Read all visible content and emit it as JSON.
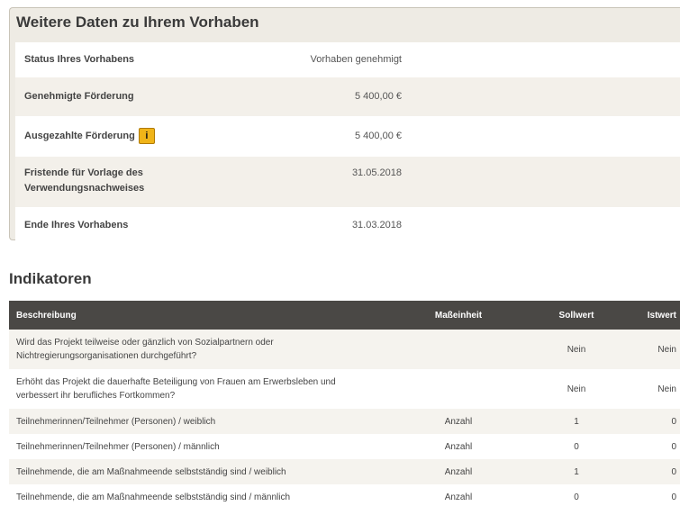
{
  "details": {
    "title": "Weitere Daten zu Ihrem Vorhaben",
    "rows": [
      {
        "label": "Status Ihres Vorhabens",
        "value": "Vorhaben genehmigt"
      },
      {
        "label": "Genehmigte Förderung",
        "value": "5 400,00 €"
      },
      {
        "label": "Ausgezahlte Förderung",
        "value": "5 400,00 €",
        "icon": "info-icon"
      },
      {
        "label": "Fristende für Vorlage des Verwendungsnachweises",
        "label_line1": "Fristende für Vorlage des",
        "label_line2": "Verwendungsnachweises",
        "value": "31.05.2018"
      },
      {
        "label": "Ende Ihres Vorhabens",
        "value": "31.03.2018"
      }
    ]
  },
  "indicators": {
    "title": "Indikatoren",
    "headers": {
      "description": "Beschreibung",
      "unit": "Maßeinheit",
      "target": "Sollwert",
      "actual": "Istwert"
    },
    "rows": [
      {
        "line1": "Wird das Projekt teilweise oder gänzlich von Sozialpartnern oder",
        "line2": "Nichtregierungsorganisationen durchgeführt?",
        "unit": "",
        "target": "Nein",
        "actual": "Nein"
      },
      {
        "line1": "Erhöht das Projekt die dauerhafte Beteiligung von Frauen am Erwerbsleben und",
        "line2": "verbessert ihr berufliches Fortkommen?",
        "unit": "",
        "target": "Nein",
        "actual": "Nein"
      },
      {
        "line1": "Teilnehmerinnen/Teilnehmer (Personen) / weiblich",
        "unit": "Anzahl",
        "target": "1",
        "actual": "0"
      },
      {
        "line1": "Teilnehmerinnen/Teilnehmer (Personen) / männlich",
        "unit": "Anzahl",
        "target": "0",
        "actual": "0"
      },
      {
        "line1": "Teilnehmende, die am Maßnahmeende selbstständig sind / weiblich",
        "unit": "Anzahl",
        "target": "1",
        "actual": "0"
      },
      {
        "line1": "Teilnehmende, die am Maßnahmeende selbstständig sind / männlich",
        "unit": "Anzahl",
        "target": "0",
        "actual": "0"
      }
    ]
  },
  "colors": {
    "header_bg": "#4a4845",
    "info_icon": "#f0b418",
    "panel_bg": "#eeebe4"
  }
}
